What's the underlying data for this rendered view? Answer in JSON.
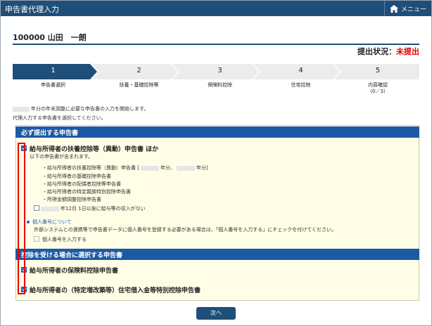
{
  "window": {
    "title": "申告書代理入力",
    "menu_label": "メニュー"
  },
  "user": {
    "name": "100000  山田　一朗"
  },
  "status": {
    "label": "提出状況：",
    "value": "未提出"
  },
  "steps": [
    {
      "num": "1",
      "label": "申告書選択"
    },
    {
      "num": "2",
      "label": "扶養・基礎控除等"
    },
    {
      "num": "3",
      "label": "保険料控除"
    },
    {
      "num": "4",
      "label": "住宅控除"
    },
    {
      "num": "5",
      "label": "内容確認",
      "sub": "（0／3）"
    }
  ],
  "intro": {
    "line1": "年分の年末調整に必要な申告書の入力を開始します。",
    "line2": "代理入力する申告書を選択してください。"
  },
  "section_required": {
    "title": "必ず提出する申告書"
  },
  "item1": {
    "title": "給与所得者の扶養控除等（異動）申告書 ほか",
    "desc": "以下の申告書が含まれます。",
    "bullet1_a": "・給与所得者の扶養控除等（異動）申告書 [",
    "bullet1_b": "年分、",
    "bullet1_c": "年分]",
    "bullets": [
      "・給与所得者の基礎控除申告書",
      "・給与所得者の配偶者控除等申告書",
      "・給与所得者の特定親族特別控除申告書",
      "・所得金額調整控除申告書"
    ],
    "dec_note": "年12月 1日以後に給与等の収入がない"
  },
  "mynumber": {
    "link": "個人番号について",
    "desc": "外部システムとの連携等で申告書データに個人番号を登録する必要がある場合は、「個人番号を入力する」にチェックを付けてください。",
    "checkbox_label": "個人番号を入力する"
  },
  "section_optional": {
    "title": "控除を受ける場合に選択する申告書"
  },
  "item2": {
    "title": "給与所得者の保険料控除申告書"
  },
  "item3": {
    "title": "給与所得者の（特定増改築等）住宅借入金等特別控除申告書"
  },
  "next_button": "次へ"
}
